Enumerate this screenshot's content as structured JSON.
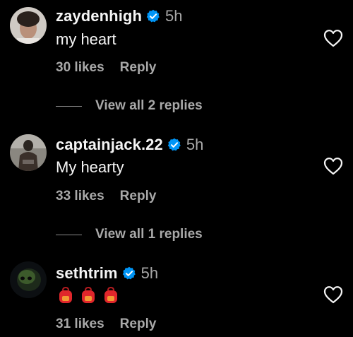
{
  "comments": [
    {
      "username": "zaydenhigh",
      "time": "5h",
      "text": "my heart",
      "likes": "30 likes",
      "reply": "Reply",
      "view_replies": "View all 2 replies"
    },
    {
      "username": "captainjack.22",
      "time": "5h",
      "text": "My hearty",
      "likes": "33 likes",
      "reply": "Reply",
      "view_replies": "View all 1 replies"
    },
    {
      "username": "sethtrim",
      "time": "5h",
      "emojis": [
        "red-backpack-emoji",
        "red-backpack-emoji",
        "red-backpack-emoji"
      ],
      "likes": "31 likes",
      "reply": "Reply"
    }
  ],
  "colors": {
    "background": "#000000",
    "text": "#f5f5f5",
    "muted": "#a8a8a8",
    "verified": "#0095f6",
    "emoji_red": "#e0262b"
  }
}
